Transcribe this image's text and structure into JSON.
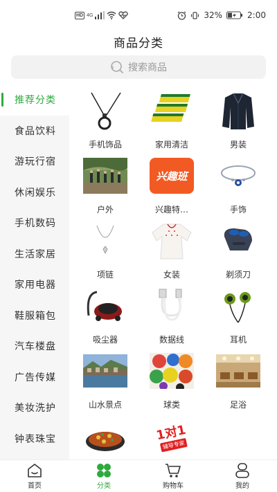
{
  "status_bar": {
    "hd_label": "HD",
    "network_label": "4G",
    "battery_percent": "32%",
    "time": "2:00"
  },
  "header": {
    "title": "商品分类"
  },
  "search": {
    "placeholder": "搜索商品"
  },
  "sidebar": {
    "items": [
      {
        "label": "推荐分类",
        "active": true
      },
      {
        "label": "食品饮料"
      },
      {
        "label": "游玩行宿"
      },
      {
        "label": "休闲娱乐"
      },
      {
        "label": "手机数码"
      },
      {
        "label": "生活家居"
      },
      {
        "label": "家用电器"
      },
      {
        "label": "鞋服箱包"
      },
      {
        "label": "汽车楼盘"
      },
      {
        "label": "广告传媒"
      },
      {
        "label": "美妆洗护"
      },
      {
        "label": "钟表珠宝"
      }
    ]
  },
  "categories": [
    {
      "label": "手机饰品",
      "icon": "phone-lanyard-icon"
    },
    {
      "label": "家用清洁",
      "icon": "cleaning-sponge-icon"
    },
    {
      "label": "男装",
      "icon": "mens-coat-icon"
    },
    {
      "label": "户外",
      "icon": "outdoor-photo"
    },
    {
      "label": "兴趣特…",
      "icon": "interest-class-logo",
      "logo_text": "兴趣班"
    },
    {
      "label": "手饰",
      "icon": "bracelet-icon"
    },
    {
      "label": "项链",
      "icon": "necklace-icon"
    },
    {
      "label": "女装",
      "icon": "womens-top-icon"
    },
    {
      "label": "剃须刀",
      "icon": "shaver-icon"
    },
    {
      "label": "吸尘器",
      "icon": "vacuum-cleaner-icon"
    },
    {
      "label": "数据线",
      "icon": "usb-cable-icon"
    },
    {
      "label": "耳机",
      "icon": "earphones-icon"
    },
    {
      "label": "山水景点",
      "icon": "scenic-spot-photo"
    },
    {
      "label": "球类",
      "icon": "balls-photo"
    },
    {
      "label": "足浴",
      "icon": "foot-spa-photo"
    },
    {
      "label": "",
      "icon": "food-dish-photo"
    },
    {
      "label": "",
      "icon": "promo-badge-logo",
      "logo_text": "1对1",
      "logo_subtext": "辅导专家"
    }
  ],
  "tab_bar": {
    "tabs": [
      {
        "label": "首页",
        "icon": "home-icon"
      },
      {
        "label": "分类",
        "icon": "category-icon",
        "active": true
      },
      {
        "label": "购物车",
        "icon": "cart-icon"
      },
      {
        "label": "我的",
        "icon": "profile-icon"
      }
    ]
  },
  "colors": {
    "accent": "#2eaa3c",
    "sidebar_bg": "#f6f6f6",
    "search_bg": "#f2f2f2"
  }
}
